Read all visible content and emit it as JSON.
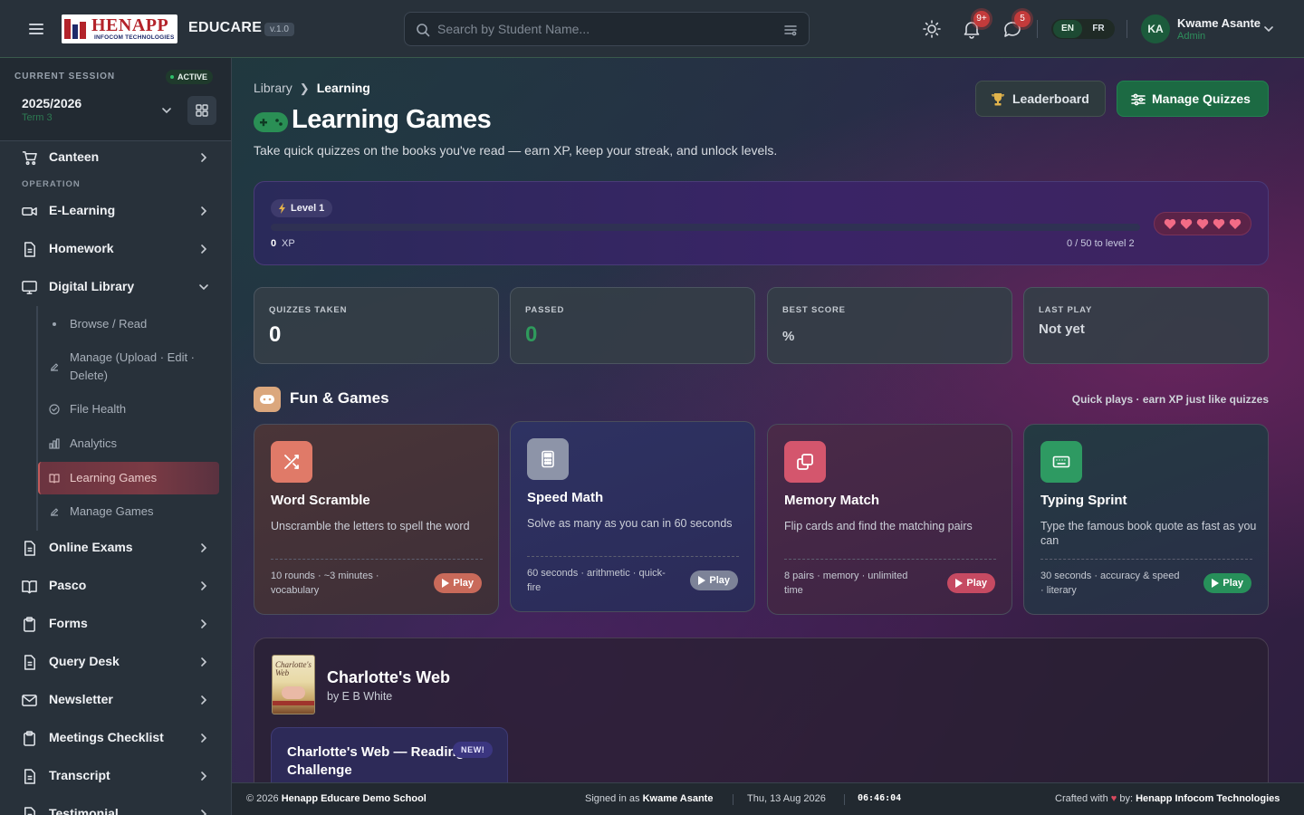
{
  "app": {
    "brand": "EDUCARE",
    "version": "v.1.0",
    "logo_text": "HENAPP",
    "logo_sub": "INFOCOM TECHNOLOGIES"
  },
  "topbar": {
    "search_placeholder": "Search by Student Name...",
    "notifications_badge": "9+",
    "messages_badge": "5",
    "languages": [
      "EN",
      "FR"
    ],
    "active_language": "EN",
    "user": {
      "initials": "KA",
      "name": "Kwame Asante",
      "role": "Admin"
    }
  },
  "sidebar": {
    "session_label": "CURRENT SESSION",
    "session_status": "ACTIVE",
    "session_year": "2025/2026",
    "session_term": "Term 3",
    "section_operation": "OPERATION",
    "items": [
      {
        "label": "Canteen",
        "icon": "cart-icon"
      },
      {
        "label": "E-Learning",
        "icon": "video-icon"
      },
      {
        "label": "Homework",
        "icon": "document-icon"
      },
      {
        "label": "Digital Library",
        "icon": "monitor-icon",
        "expanded": true
      },
      {
        "label": "Online Exams",
        "icon": "document-icon"
      },
      {
        "label": "Pasco",
        "icon": "book-icon"
      },
      {
        "label": "Forms",
        "icon": "clipboard-icon"
      },
      {
        "label": "Query Desk",
        "icon": "document-icon"
      },
      {
        "label": "Newsletter",
        "icon": "mail-icon"
      },
      {
        "label": "Meetings Checklist",
        "icon": "clipboard-icon"
      },
      {
        "label": "Transcript",
        "icon": "document-icon"
      },
      {
        "label": "Testimonial",
        "icon": "document-icon"
      }
    ],
    "library_subitems": [
      {
        "label": "Browse / Read",
        "icon": "dot-icon"
      },
      {
        "label": "Manage (Upload · Edit · Delete)",
        "icon": "edit-icon"
      },
      {
        "label": "File Health",
        "icon": "check-circle-icon"
      },
      {
        "label": "Analytics",
        "icon": "chart-icon"
      },
      {
        "label": "Learning Games",
        "icon": "book-icon",
        "selected": true
      },
      {
        "label": "Manage Games",
        "icon": "edit-icon"
      }
    ]
  },
  "main": {
    "breadcrumb": {
      "parent": "Library",
      "current": "Learning"
    },
    "title": "Learning Games",
    "subtitle": "Take quick quizzes on the books you've read — earn XP, keep your streak, and unlock levels.",
    "buttons": {
      "leaderboard": "Leaderboard",
      "manage_quizzes": "Manage Quizzes"
    },
    "level": {
      "badge": "Level 1",
      "xp": "0",
      "xp_unit": "XP",
      "progress_text": "0 / 50 to level 2",
      "progress_fraction": 0.0,
      "hearts": 5
    },
    "stats": [
      {
        "label": "QUIZZES TAKEN",
        "value": "0"
      },
      {
        "label": "PASSED",
        "value": "0"
      },
      {
        "label": "BEST SCORE",
        "value": "%"
      },
      {
        "label": "LAST PLAY",
        "value": "Not yet"
      }
    ],
    "fun_section": {
      "title": "Fun & Games",
      "hint": "Quick plays · earn XP just like quizzes"
    },
    "games": [
      {
        "title": "Word Scramble",
        "desc": "Unscramble the letters to spell the word",
        "meta": "10 rounds · ~3 minutes · vocabulary",
        "play": "Play",
        "icon": "shuffle-icon",
        "accent": "#e07a68"
      },
      {
        "title": "Speed Math",
        "desc": "Solve as many as you can in 60 seconds",
        "meta": "60 seconds · arithmetic · quick-fire",
        "play": "Play",
        "icon": "calculator-icon",
        "accent": "#8d94a8"
      },
      {
        "title": "Memory Match",
        "desc": "Flip cards and find the matching pairs",
        "meta": "8 pairs · memory · unlimited time",
        "play": "Play",
        "icon": "cards-icon",
        "accent": "#d4566d"
      },
      {
        "title": "Typing Sprint",
        "desc": "Type the famous book quote as fast as you can",
        "meta": "30 seconds · accuracy & speed · literary",
        "play": "Play",
        "icon": "keyboard-icon",
        "accent": "#2e9a62"
      }
    ],
    "book": {
      "title": "Charlotte's Web",
      "author": "by E B White",
      "cover_text": "Charlotte's Web",
      "challenge": "Charlotte's Web — Reading Challenge",
      "badge": "NEW!"
    }
  },
  "footer": {
    "copyright": "© 2026",
    "school": "Henapp Educare Demo School",
    "signed_in_prefix": "Signed in as",
    "signed_in_user": "Kwame Asante",
    "date": "Thu, 13 Aug 2026",
    "time": "06:46:04",
    "crafted_prefix": "Crafted with",
    "crafted_by": "by:",
    "company": "Henapp Infocom Technologies"
  },
  "colors": {
    "brand_green": "#1c6a43",
    "accent_red": "#c33b3b",
    "selected_nav": "#7a3a44"
  }
}
